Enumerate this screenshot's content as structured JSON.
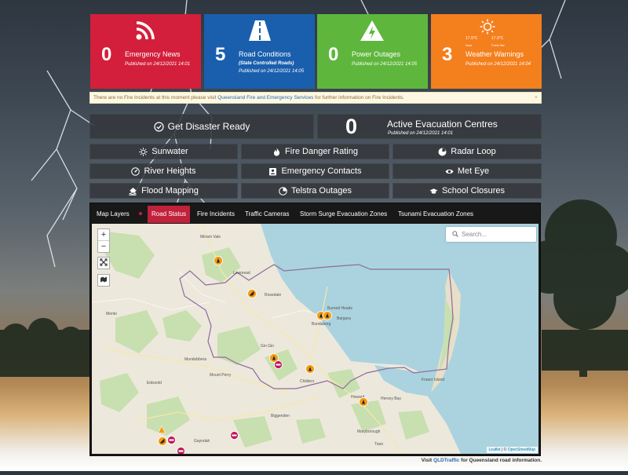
{
  "tiles": [
    {
      "count": "0",
      "title": "Emergency News",
      "subtitle": "",
      "published": "Published on 24/12/2021 14:01",
      "color": "#d31f3b",
      "icon": "rss-icon"
    },
    {
      "count": "5",
      "title": "Road Conditions",
      "subtitle": "(State Controlled Roads)",
      "published": "Published on 24/12/2021 14:05",
      "color": "#1a5fad",
      "icon": "road-icon"
    },
    {
      "count": "0",
      "title": "Power Outages",
      "subtitle": "",
      "published": "Published on 24/12/2021 14:05",
      "color": "#5fb63c",
      "icon": "lightning-icon"
    },
    {
      "count": "3",
      "title": "Weather Warnings",
      "subtitle": "",
      "published": "Published on 24/12/2021 14:04",
      "color": "#f47f1d",
      "icon": "sun-icon"
    }
  ],
  "weather_mini": {
    "temp1": "17.9°C",
    "temp2": "17.9°C",
    "label1": "Now",
    "label2": "Feels like"
  },
  "notice": {
    "text_before": "There are no Fire Incidents at this moment please visit ",
    "link": "Queensland Fire and Emergency Services",
    "text_after": " for further information on Fire Incidents.",
    "close": "×"
  },
  "get_ready": {
    "label": "Get Disaster Ready",
    "icon": "check-circle-icon"
  },
  "evacuation": {
    "count": "0",
    "title": "Active Evacuation Centres",
    "published": "Published on 24/12/2021 14:01"
  },
  "buttons": [
    {
      "label": "Sunwater",
      "icon": "sun-icon"
    },
    {
      "label": "Fire Danger Rating",
      "icon": "flame-icon"
    },
    {
      "label": "Radar Loop",
      "icon": "radar-icon"
    },
    {
      "label": "River Heights",
      "icon": "gauge-icon"
    },
    {
      "label": "Emergency Contacts",
      "icon": "contact-card-icon"
    },
    {
      "label": "Met Eye",
      "icon": "eye-icon"
    },
    {
      "label": "Flood Mapping",
      "icon": "flood-house-icon"
    },
    {
      "label": "Telstra Outages",
      "icon": "pie-chart-icon"
    },
    {
      "label": "School Closures",
      "icon": "graduation-cap-icon"
    }
  ],
  "map_tabs": {
    "label": "Map Layers",
    "items": [
      "Road Status",
      "Fire Incidents",
      "Traffic Cameras",
      "Storm Surge Evacuation Zones",
      "Tsunami Evacuation Zones"
    ],
    "active": "Road Status"
  },
  "map": {
    "zoom_in": "+",
    "zoom_out": "−",
    "search_placeholder": "Search...",
    "attribution_leaflet": "Leaflet",
    "attribution_sep": " | © ",
    "attribution_osm": "OpenStreetMap",
    "towns": [
      "Miriam Vale",
      "Lowmead",
      "Rosedale",
      "Bundaberg",
      "Burnett Heads",
      "Bargara",
      "Childers",
      "Gin Gin",
      "Biggenden",
      "Maryborough",
      "Hervey Bay",
      "Howard",
      "Mount Perry",
      "Gayndah",
      "Eidsvold",
      "Monto",
      "Mundubbera",
      "Tiaro",
      "Fraser Island"
    ],
    "accent": "#c0213b",
    "water": "#aad3df",
    "park": "#c8dfb0"
  },
  "footer": {
    "before": "Visit ",
    "link": "QLDTraffic",
    "after": " for Queensland road information."
  }
}
